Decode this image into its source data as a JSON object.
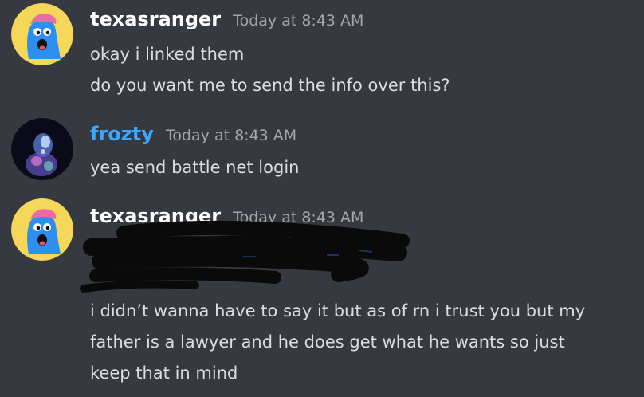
{
  "theme": {
    "background": "#36393f",
    "text": "#dcddde",
    "username_default": "#ffffff",
    "username_frozty": "#3ea6ff",
    "timestamp": "#a3a6aa"
  },
  "messages": [
    {
      "username": "texasranger",
      "timestamp": "Today at 8:43 AM",
      "avatar_icon": "blue-blob-avatar",
      "lines": [
        "okay i linked them",
        "do you want me to send the info over this?"
      ]
    },
    {
      "username": "frozty",
      "timestamp": "Today at 8:43 AM",
      "avatar_icon": "glowing-figure-avatar",
      "lines": [
        "yea send battle net login"
      ]
    },
    {
      "username": "texasranger",
      "timestamp": "Today at 8:43 AM",
      "avatar_icon": "blue-blob-avatar",
      "redacted": true,
      "lines": [
        "i didn’t wanna have to say it but as of rn i trust you but my",
        "father is a lawyer and he does get what he wants so just",
        "keep that in mind"
      ]
    }
  ]
}
